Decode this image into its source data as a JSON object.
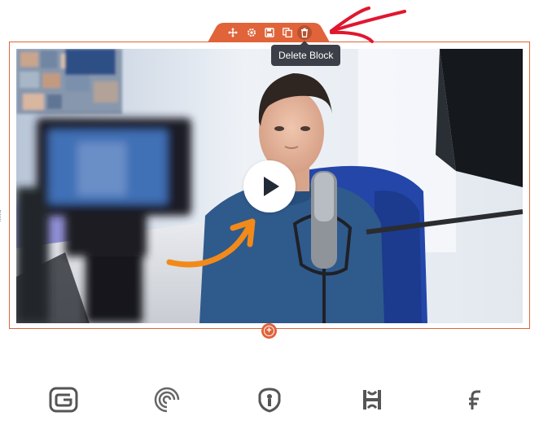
{
  "toolbar": {
    "tooltip": "Delete Block",
    "icons": [
      "move-icon",
      "settings-icon",
      "save-icon",
      "duplicate-icon",
      "delete-icon"
    ],
    "accent_color": "#e0633a"
  },
  "video": {
    "play_icon": "play-icon"
  },
  "add_block": {
    "icon": "plus-circle-icon"
  },
  "logos": [
    "g-logo",
    "swirl-logo",
    "shield-logo",
    "h-logo",
    "f-logo"
  ],
  "annotations": {
    "arrow_color": "#e0172f",
    "curve_arrow_color": "#f28a1a"
  }
}
